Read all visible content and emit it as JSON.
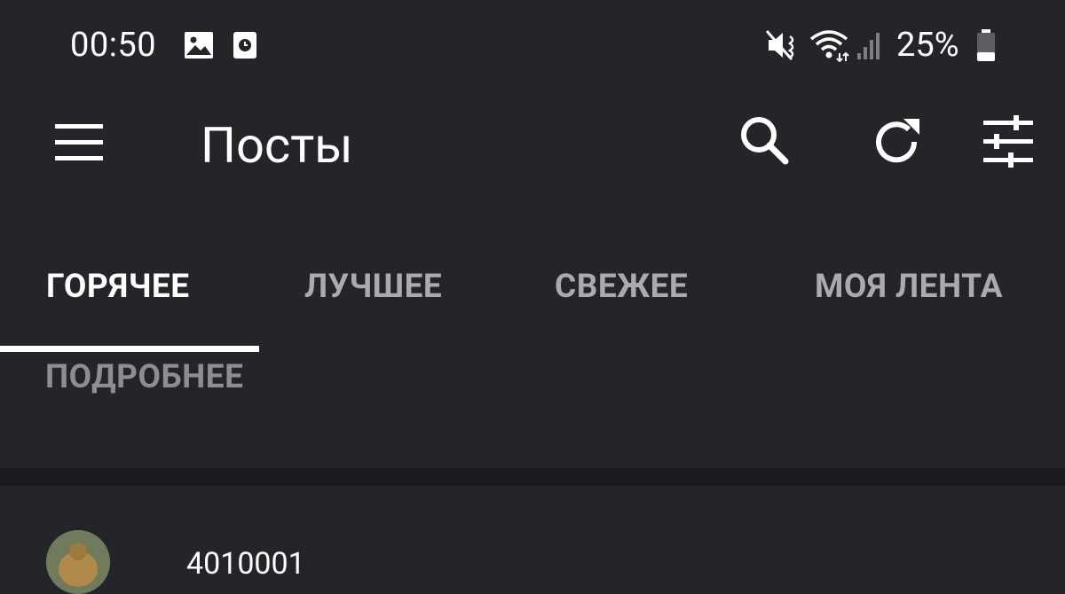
{
  "statusbar": {
    "time": "00:50",
    "battery": "25%",
    "icons": [
      "image-icon",
      "clock-notification-icon",
      "mute-icon",
      "wifi-icon",
      "signal-icon",
      "battery-icon"
    ]
  },
  "appbar": {
    "title": "Посты",
    "icons": [
      "menu-icon",
      "search-icon",
      "refresh-icon",
      "filter-icon"
    ]
  },
  "tabs": [
    {
      "label": "ГОРЯЧЕЕ",
      "active": true
    },
    {
      "label": "ЛУЧШЕЕ",
      "active": false
    },
    {
      "label": "СВЕЖЕЕ",
      "active": false
    },
    {
      "label": "МОЯ ЛЕНТА",
      "active": false
    }
  ],
  "content": {
    "more_label": "ПОДРОБНЕЕ",
    "post_author": "4010001"
  },
  "colors": {
    "background": "#232529",
    "divider": "#1a1b1e",
    "tab_inactive": "#a9abaf",
    "tab_active": "#ffffff"
  }
}
